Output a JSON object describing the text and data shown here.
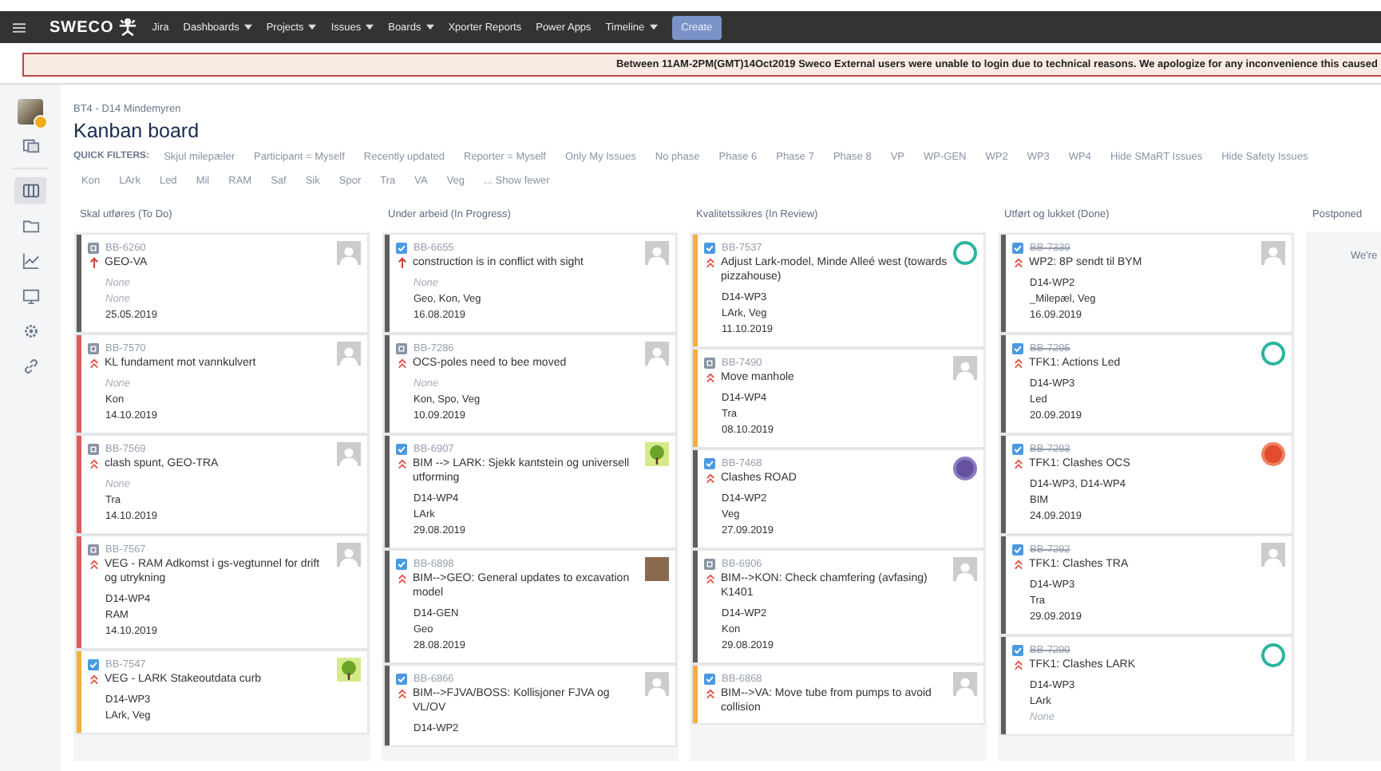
{
  "nav": {
    "logo": "SWECO",
    "product": "Jira",
    "items": [
      {
        "label": "Dashboards",
        "dropdown": true
      },
      {
        "label": "Projects",
        "dropdown": true
      },
      {
        "label": "Issues",
        "dropdown": true
      },
      {
        "label": "Boards",
        "dropdown": true
      },
      {
        "label": "Xporter Reports",
        "dropdown": false
      },
      {
        "label": "Power Apps",
        "dropdown": false
      },
      {
        "label": "Timeline",
        "dropdown": true
      }
    ],
    "create": "Create"
  },
  "banner": "Between 11AM-2PM(GMT)14Oct2019 Sweco External users were unable to login due to technical reasons. We apologize for any inconvenience this caused",
  "sidebar": {
    "items": [
      {
        "kind": "pages",
        "selected": false
      },
      {
        "kind": "board",
        "selected": true
      },
      {
        "kind": "folder",
        "selected": false
      },
      {
        "kind": "chart",
        "selected": false
      },
      {
        "kind": "monitor",
        "selected": false
      },
      {
        "kind": "gear",
        "selected": false
      },
      {
        "kind": "link",
        "selected": false
      }
    ]
  },
  "breadcrumb": "BT4 - D14 Mindemyren",
  "title": "Kanban board",
  "quick_filters": {
    "label": "QUICK FILTERS:",
    "row_1": [
      "Skjul milepæler",
      "Participant = Myself",
      "Recently updated",
      "Reporter = Myself",
      "Only My Issues",
      "No phase",
      "Phase 6",
      "Phase 7",
      "Phase 8",
      "VP",
      "WP-GEN",
      "WP2",
      "WP3",
      "WP4",
      "Hide SMaRT Issues",
      "Hide Safety Issues"
    ],
    "row_2": [
      "Kon",
      "LArk",
      "Led",
      "Mil",
      "RAM",
      "Saf",
      "Sik",
      "Spor",
      "Tra",
      "VA",
      "Veg"
    ],
    "show_fewer": "... Show fewer"
  },
  "columns": [
    {
      "title": "Skal utføres (To Do)",
      "cards": [
        {
          "key": "BB-6260",
          "resolved": false,
          "type": {
            "kind": "subtask"
          },
          "priority": {
            "kind": "highest"
          },
          "summary": "GEO-VA",
          "fields": [
            {
              "text": "None",
              "empty": true
            },
            {
              "text": "None",
              "empty": true
            },
            {
              "text": "25.05.2019",
              "empty": false
            }
          ],
          "avatar": {
            "kind": "blank"
          },
          "color": "#5e5e5e"
        },
        {
          "key": "BB-7570",
          "resolved": false,
          "type": {
            "kind": "subtask"
          },
          "priority": {
            "kind": "high"
          },
          "summary": "KL fundament mot vannkulvert",
          "fields": [
            {
              "text": "None",
              "empty": true
            },
            {
              "text": "Kon",
              "empty": false
            },
            {
              "text": "14.10.2019",
              "empty": false
            }
          ],
          "avatar": {
            "kind": "blank"
          },
          "color": "#e05a5a"
        },
        {
          "key": "BB-7569",
          "resolved": false,
          "type": {
            "kind": "subtask"
          },
          "priority": {
            "kind": "high"
          },
          "summary": "clash spunt, GEO-TRA",
          "fields": [
            {
              "text": "None",
              "empty": true
            },
            {
              "text": "Tra",
              "empty": false
            },
            {
              "text": "14.10.2019",
              "empty": false
            }
          ],
          "avatar": {
            "kind": "blank"
          },
          "color": "#e05a5a"
        },
        {
          "key": "BB-7567",
          "resolved": false,
          "type": {
            "kind": "subtask"
          },
          "priority": {
            "kind": "high"
          },
          "summary": "VEG - RAM Adkomst i gs-vegtunnel for drift og utrykning",
          "fields": [
            {
              "text": "D14-WP4",
              "empty": false
            },
            {
              "text": "RAM",
              "empty": false
            },
            {
              "text": "14.10.2019",
              "empty": false
            }
          ],
          "avatar": {
            "kind": "blank"
          },
          "color": "#e05a5a"
        },
        {
          "key": "BB-7547",
          "resolved": false,
          "type": {
            "kind": "task"
          },
          "priority": {
            "kind": "high"
          },
          "summary": "VEG - LARK Stakeoutdata curb",
          "fields": [
            {
              "text": "D14-WP3",
              "empty": false
            },
            {
              "text": "LArk, Veg",
              "empty": false
            }
          ],
          "avatar": {
            "kind": "tree"
          },
          "color": "#f0b03c"
        }
      ]
    },
    {
      "title": "Under arbeid (In Progress)",
      "cards": [
        {
          "key": "BB-6655",
          "resolved": false,
          "type": {
            "kind": "task"
          },
          "priority": {
            "kind": "highest"
          },
          "summary": "construction is in conflict with sight",
          "fields": [
            {
              "text": "None",
              "empty": true
            },
            {
              "text": "Geo, Kon, Veg",
              "empty": false
            },
            {
              "text": "16.08.2019",
              "empty": false
            }
          ],
          "avatar": {
            "kind": "blank"
          },
          "color": "#5e5e5e"
        },
        {
          "key": "BB-7286",
          "resolved": false,
          "type": {
            "kind": "subtask"
          },
          "priority": {
            "kind": "high"
          },
          "summary": "OCS-poles need to bee moved",
          "fields": [
            {
              "text": "None",
              "empty": true
            },
            {
              "text": "Kon, Spo, Veg",
              "empty": false
            },
            {
              "text": "10.09.2019",
              "empty": false
            }
          ],
          "avatar": {
            "kind": "blank"
          },
          "color": "#5e5e5e"
        },
        {
          "key": "BB-6907",
          "resolved": false,
          "type": {
            "kind": "task"
          },
          "priority": {
            "kind": "high"
          },
          "summary": "BIM --> LARK: Sjekk kantstein og universell utforming",
          "fields": [
            {
              "text": "D14-WP4",
              "empty": false
            },
            {
              "text": "LArk",
              "empty": false
            },
            {
              "text": "29.08.2019",
              "empty": false
            }
          ],
          "avatar": {
            "kind": "tree"
          },
          "color": "#5e5e5e"
        },
        {
          "key": "BB-6898",
          "resolved": false,
          "type": {
            "kind": "task"
          },
          "priority": {
            "kind": "high"
          },
          "summary": "BIM-->GEO: General updates to excavation model",
          "fields": [
            {
              "text": "D14-GEN",
              "empty": false
            },
            {
              "text": "Geo",
              "empty": false
            },
            {
              "text": "28.08.2019",
              "empty": false
            }
          ],
          "avatar": {
            "kind": "photo"
          },
          "color": "#5e5e5e"
        },
        {
          "key": "BB-6866",
          "resolved": false,
          "type": {
            "kind": "task"
          },
          "priority": {
            "kind": "high"
          },
          "summary": "BIM-->FJVA/BOSS: Kollisjoner FJVA og VL/OV",
          "fields": [
            {
              "text": "D14-WP2",
              "empty": false
            }
          ],
          "avatar": {
            "kind": "blank"
          },
          "color": "#5e5e5e"
        }
      ]
    },
    {
      "title": "Kvalitetssikres (In Review)",
      "cards": [
        {
          "key": "BB-7537",
          "resolved": false,
          "type": {
            "kind": "task"
          },
          "priority": {
            "kind": "high"
          },
          "summary": "Adjust Lark-model, Minde Alleé west (towards pizzahouse)",
          "fields": [
            {
              "text": "D14-WP3",
              "empty": false
            },
            {
              "text": "LArk, Veg",
              "empty": false
            },
            {
              "text": "11.10.2019",
              "empty": false
            }
          ],
          "avatar": {
            "kind": "teal"
          },
          "color": "#f0b03c"
        },
        {
          "key": "BB-7490",
          "resolved": false,
          "type": {
            "kind": "subtask"
          },
          "priority": {
            "kind": "high"
          },
          "summary": "Move manhole",
          "fields": [
            {
              "text": "D14-WP4",
              "empty": false
            },
            {
              "text": "Tra",
              "empty": false
            },
            {
              "text": "08.10.2019",
              "empty": false
            }
          ],
          "avatar": {
            "kind": "blank"
          },
          "color": "#f0b03c"
        },
        {
          "key": "BB-7468",
          "resolved": false,
          "type": {
            "kind": "task"
          },
          "priority": {
            "kind": "high"
          },
          "summary": "Clashes ROAD",
          "fields": [
            {
              "text": "D14-WP2",
              "empty": false
            },
            {
              "text": "Veg",
              "empty": false
            },
            {
              "text": "27.09.2019",
              "empty": false
            }
          ],
          "avatar": {
            "kind": "purple"
          },
          "color": "#5e5e5e"
        },
        {
          "key": "BB-6906",
          "resolved": false,
          "type": {
            "kind": "subtask"
          },
          "priority": {
            "kind": "high"
          },
          "summary": "BIM-->KON: Check chamfering (avfasing) K1401",
          "fields": [
            {
              "text": "D14-WP2",
              "empty": false
            },
            {
              "text": "Kon",
              "empty": false
            },
            {
              "text": "29.08.2019",
              "empty": false
            }
          ],
          "avatar": {
            "kind": "blank"
          },
          "color": "#5e5e5e"
        },
        {
          "key": "BB-6868",
          "resolved": false,
          "type": {
            "kind": "task"
          },
          "priority": {
            "kind": "high"
          },
          "summary": "BIM-->VA: Move tube from pumps to avoid collision",
          "avatar": {
            "kind": "blank"
          },
          "color": "#f0b03c"
        }
      ]
    },
    {
      "title": "Utført og lukket (Done)",
      "cards": [
        {
          "key": "BB-7339",
          "resolved": true,
          "type": {
            "kind": "task"
          },
          "priority": {
            "kind": "high"
          },
          "summary": "WP2: 8P sendt til BYM",
          "fields": [
            {
              "text": "D14-WP2",
              "empty": false
            },
            {
              "text": "_Milepæl, Veg",
              "empty": false
            },
            {
              "text": "16.09.2019",
              "empty": false
            }
          ],
          "avatar": {
            "kind": "blank"
          },
          "color": "#5e5e5e"
        },
        {
          "key": "BB-7295",
          "resolved": true,
          "type": {
            "kind": "task"
          },
          "priority": {
            "kind": "high"
          },
          "summary": "TFK1: Actions Led",
          "fields": [
            {
              "text": "D14-WP3",
              "empty": false
            },
            {
              "text": "Led",
              "empty": false
            },
            {
              "text": "20.09.2019",
              "empty": false
            }
          ],
          "avatar": {
            "kind": "teal"
          },
          "color": "#5e5e5e"
        },
        {
          "key": "BB-7293",
          "resolved": true,
          "type": {
            "kind": "task"
          },
          "priority": {
            "kind": "high"
          },
          "summary": "TFK1: Clashes OCS",
          "fields": [
            {
              "text": "D14-WP3, D14-WP4",
              "empty": false
            },
            {
              "text": "BIM",
              "empty": false
            },
            {
              "text": "24.09.2019",
              "empty": false
            }
          ],
          "avatar": {
            "kind": "red"
          },
          "color": "#5e5e5e"
        },
        {
          "key": "BB-7292",
          "resolved": true,
          "type": {
            "kind": "task"
          },
          "priority": {
            "kind": "high"
          },
          "summary": "TFK1: Clashes TRA",
          "fields": [
            {
              "text": "D14-WP3",
              "empty": false
            },
            {
              "text": "Tra",
              "empty": false
            },
            {
              "text": "29.09.2019",
              "empty": false
            }
          ],
          "avatar": {
            "kind": "blank"
          },
          "color": "#5e5e5e"
        },
        {
          "key": "BB-7290",
          "resolved": true,
          "type": {
            "kind": "task"
          },
          "priority": {
            "kind": "high"
          },
          "summary": "TFK1: Clashes LARK",
          "fields": [
            {
              "text": "D14-WP3",
              "empty": false
            },
            {
              "text": "LArk",
              "empty": false
            },
            {
              "text": "None",
              "empty": true
            }
          ],
          "avatar": {
            "kind": "teal"
          },
          "color": "#5e5e5e"
        }
      ]
    },
    {
      "title": "Postponed",
      "message": "We're"
    }
  ]
}
